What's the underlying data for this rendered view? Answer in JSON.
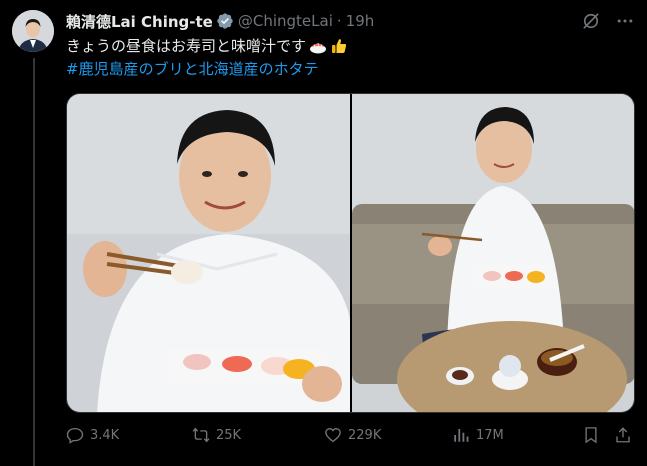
{
  "tweet": {
    "display_name": "賴清德Lai Ching-te",
    "handle": "@ChingteLai",
    "separator": "·",
    "time": "19h",
    "text": "きょうの昼食はお寿司と味噌汁です",
    "hashtag_line": "#鹿児島産のブリと北海道産のホタテ"
  },
  "icons": {
    "verified": "verified-badge-icon",
    "grok": "grok-icon",
    "more": "more-options-icon",
    "reply": "reply-icon",
    "retweet": "retweet-icon",
    "like": "like-icon",
    "views": "views-icon",
    "bookmark": "bookmark-icon",
    "share": "share-icon"
  },
  "stats": {
    "replies": "3.4K",
    "retweets": "25K",
    "likes": "229K",
    "views": "17M"
  },
  "colors": {
    "background": "#000000",
    "text": "#e7e9ea",
    "muted": "#71767b",
    "link": "#1d9bf0",
    "verified": "#829aab"
  }
}
